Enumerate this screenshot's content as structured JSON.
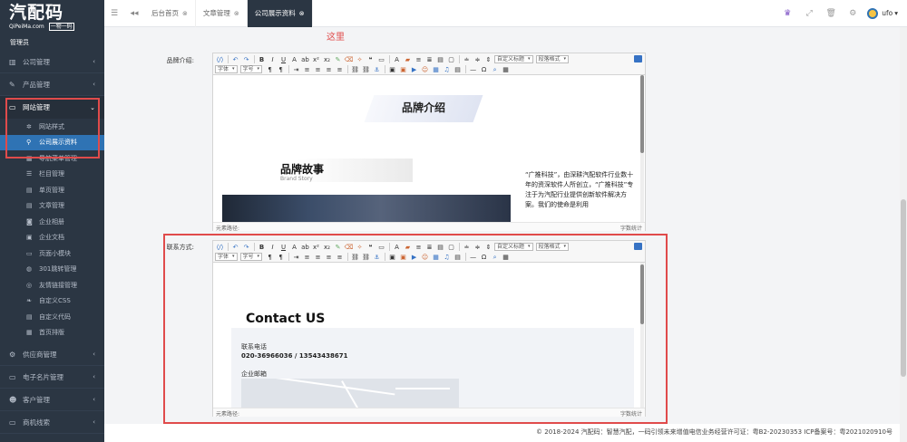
{
  "sidebar": {
    "logo_title": "汽配码",
    "logo_site": "QiPeiMa.com",
    "logo_tag": "一物一码",
    "admin_label": "管理员",
    "groups": [
      {
        "label": "公司管理",
        "arrow": "‹"
      },
      {
        "label": "产品管理",
        "arrow": "‹"
      },
      {
        "label": "网站管理",
        "arrow": "⌄"
      }
    ],
    "subitems": [
      {
        "label": "网站样式"
      },
      {
        "label": "公司展示资料"
      },
      {
        "label": "导航菜单管理"
      },
      {
        "label": "栏目管理"
      },
      {
        "label": "单页管理"
      },
      {
        "label": "文章管理"
      },
      {
        "label": "企业相册"
      },
      {
        "label": "企业文档"
      },
      {
        "label": "页面小模块"
      },
      {
        "label": "301跳转管理"
      },
      {
        "label": "友情链接管理"
      },
      {
        "label": "自定义CSS"
      },
      {
        "label": "自定义代码"
      },
      {
        "label": "首页排版"
      }
    ],
    "bottom_groups": [
      {
        "label": "供应商管理",
        "arrow": "‹"
      },
      {
        "label": "电子名片管理",
        "arrow": "‹"
      },
      {
        "label": "客户管理",
        "arrow": "‹"
      },
      {
        "label": "商机线索",
        "arrow": "‹"
      }
    ]
  },
  "topbar": {
    "tabs": [
      {
        "label": "后台首页",
        "close": "⊗"
      },
      {
        "label": "文章管理",
        "close": "⊗"
      },
      {
        "label": "公司展示资料",
        "close": "⊗"
      }
    ],
    "user": "ufo",
    "user_caret": "▾"
  },
  "annotation": "这里",
  "fields": {
    "brand_label": "品牌介绍:",
    "contact_label": "联系方式:"
  },
  "toolbar": {
    "custom_title": "自定义标题",
    "paragraph_format": "段落格式",
    "font_family": "字体",
    "font_size": "字号"
  },
  "brand_content": {
    "heading": "品牌介绍",
    "story_title": "品牌故事",
    "story_sub": "Brand Story",
    "intro_text": "“广推科技”，由深耕汽配软件行业数十年的资深软件人所创立，“广推科技”专注于为汽配行业提供创新软件解决方案。我们的使命是利用"
  },
  "contact_content": {
    "heading": "Contact US",
    "phone_label": "联系电话",
    "phone_value": "020-36966036 / 13543438671",
    "email_label": "企业邮箱"
  },
  "status": {
    "path_label": "元素路径:",
    "word_count": "字数统计"
  },
  "footer": "© 2018-2024 汽配码：智慧汽配，一码引领未来增值电信业务经营许可证：粤B2-20230353 ICP备案号：粤2021020910号",
  "colors": {
    "sidebar_bg": "#2b3643",
    "active_blue": "#2f73b4",
    "highlight_red": "#e04b4b"
  }
}
